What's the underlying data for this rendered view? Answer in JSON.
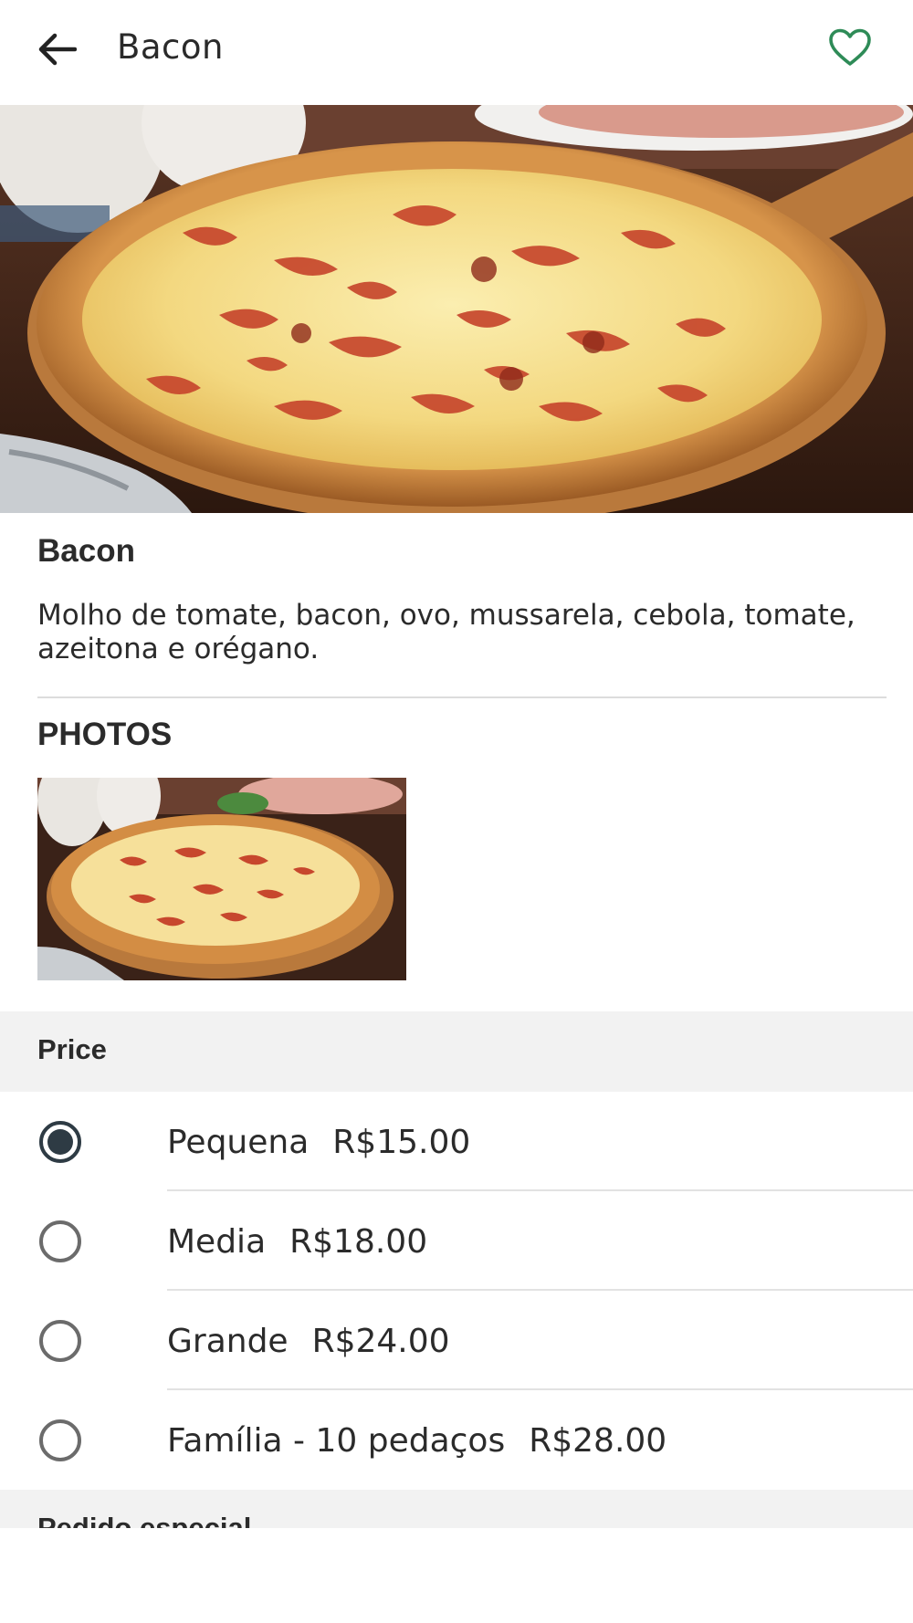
{
  "header": {
    "title": "Bacon",
    "back_icon": "arrow-left-icon",
    "favorite_icon": "heart-outline-icon",
    "favorite_color": "#2e8b57"
  },
  "hero": {
    "alt": "pizza-photo"
  },
  "product": {
    "name": "Bacon",
    "description": "Molho de tomate, bacon, ovo, mussarela, cebola, tomate, azeitona e orégano."
  },
  "photos": {
    "heading": "PHOTOS"
  },
  "price": {
    "heading": "Price",
    "selected_index": 0,
    "options": [
      {
        "label": "Pequena",
        "price": "R$15.00"
      },
      {
        "label": "Media",
        "price": "R$18.00"
      },
      {
        "label": "Grande",
        "price": "R$24.00"
      },
      {
        "label": "Família - 10 pedaços",
        "price": "R$28.00"
      }
    ]
  },
  "special_request": {
    "heading": "Pedido especial"
  },
  "colors": {
    "radio_selected": "#2e3b44",
    "radio_unselected": "#6b6b6b",
    "section_bg": "#f2f2f2"
  }
}
